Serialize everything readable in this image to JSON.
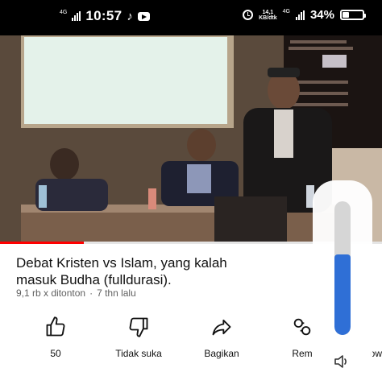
{
  "status_bar": {
    "network_left": "4G",
    "time": "10:57",
    "net_speed_value": "14,1",
    "net_speed_unit": "KB/dtk",
    "network_right": "4G",
    "battery_percent": "34%",
    "battery_level": 0.34
  },
  "video": {
    "progress": 0.22
  },
  "title": {
    "line1": "Debat Kristen vs Islam, yang kalah",
    "line2": "masuk Budha (fulldurasi)."
  },
  "meta": {
    "views": "9,1 rb x ditonton",
    "separator": "·",
    "age": "7 thn lalu"
  },
  "actions": {
    "like_count": "50",
    "dislike_label": "Tidak suka",
    "share_label": "Bagikan",
    "remix_label": "Rem",
    "download_label_partial": "ow"
  },
  "volume": {
    "level": 0.6
  },
  "icons": {
    "like": "thumbs-up-icon",
    "dislike": "thumbs-down-icon",
    "share": "share-arrow-icon",
    "remix": "remix-icon",
    "volume": "speaker-icon",
    "alarm": "alarm-clock-icon",
    "tiktok": "tiktok-icon",
    "youtube": "youtube-icon"
  },
  "colors": {
    "progress_red": "#ff0000",
    "volume_blue": "#2f6fd6",
    "meta_gray": "#606060"
  }
}
